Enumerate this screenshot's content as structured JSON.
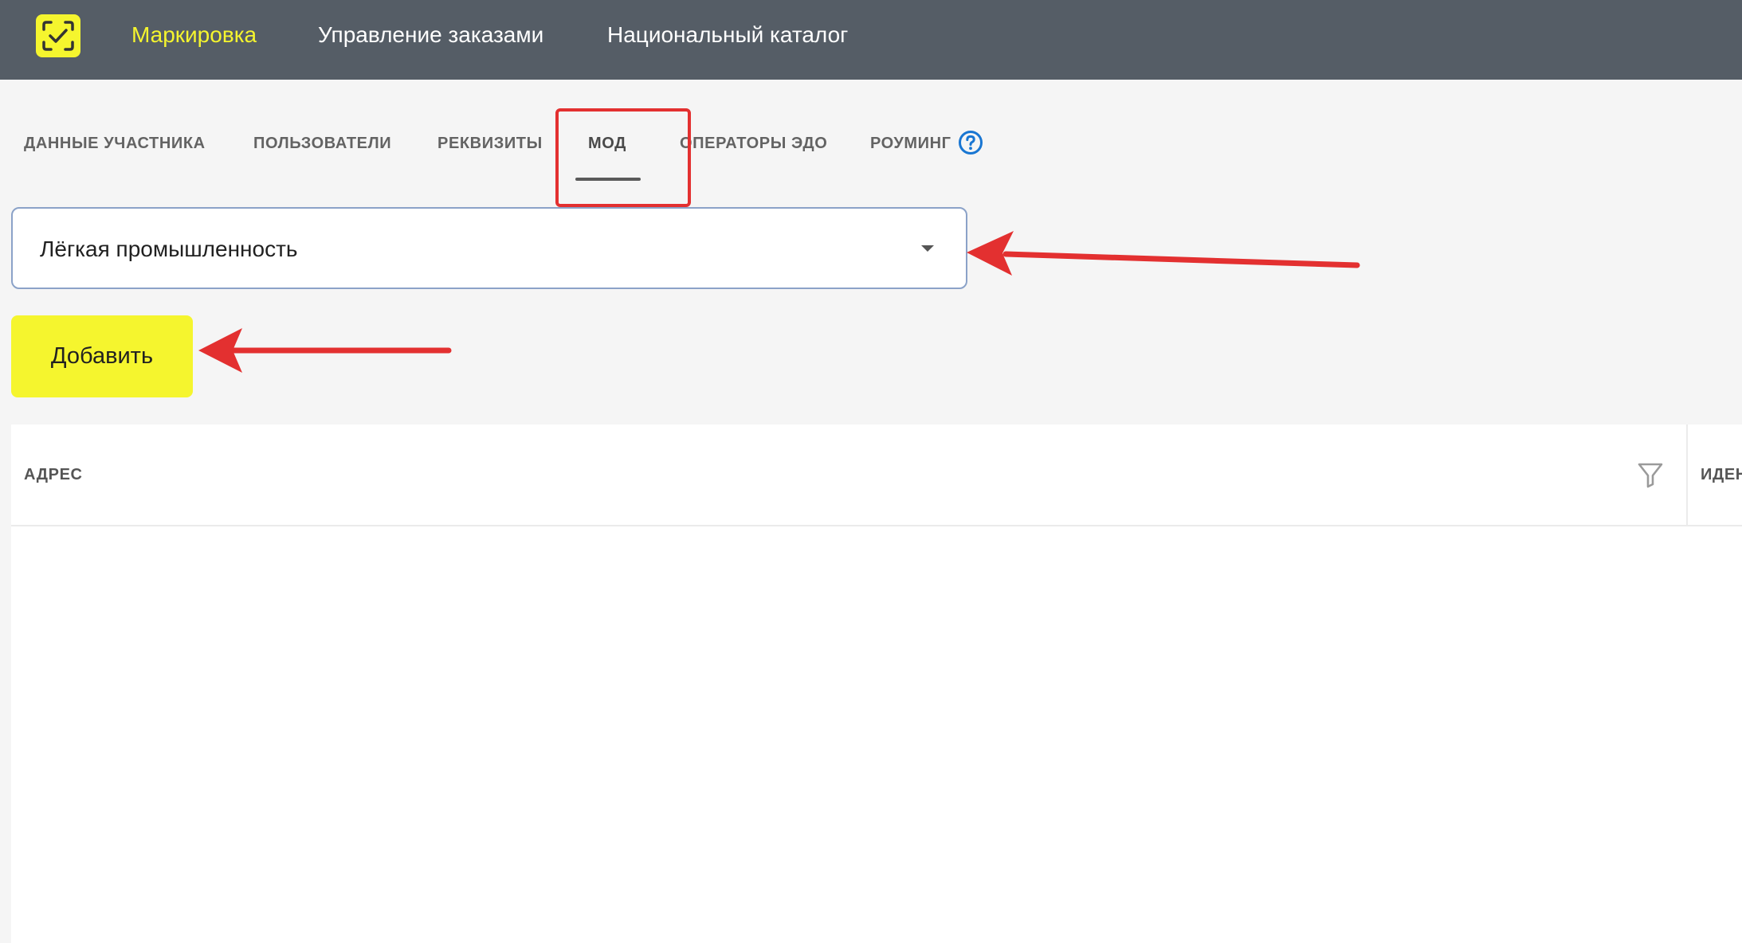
{
  "header": {
    "nav": [
      {
        "label": "Маркировка",
        "active": true
      },
      {
        "label": "Управление заказами",
        "active": false
      },
      {
        "label": "Национальный каталог",
        "active": false
      }
    ]
  },
  "tabs": [
    {
      "label": "ДАННЫЕ УЧАСТНИКА",
      "active": false
    },
    {
      "label": "ПОЛЬЗОВАТЕЛИ",
      "active": false
    },
    {
      "label": "РЕКВИЗИТЫ",
      "active": false
    },
    {
      "label": "МОД",
      "active": true
    },
    {
      "label": "ОПЕРАТОРЫ ЭДО",
      "active": false
    },
    {
      "label": "РОУМИНГ",
      "active": false
    }
  ],
  "help_icon": "question-circle-icon",
  "select": {
    "value": "Лёгкая промышленность"
  },
  "add_button": {
    "label": "Добавить"
  },
  "table": {
    "columns": [
      "АДРЕС",
      "ИДЕН"
    ],
    "rows": []
  },
  "colors": {
    "topbar": "#555d66",
    "accent_yellow": "#f5f52e",
    "annotation_red": "#e33030",
    "help_blue": "#1976d2"
  }
}
